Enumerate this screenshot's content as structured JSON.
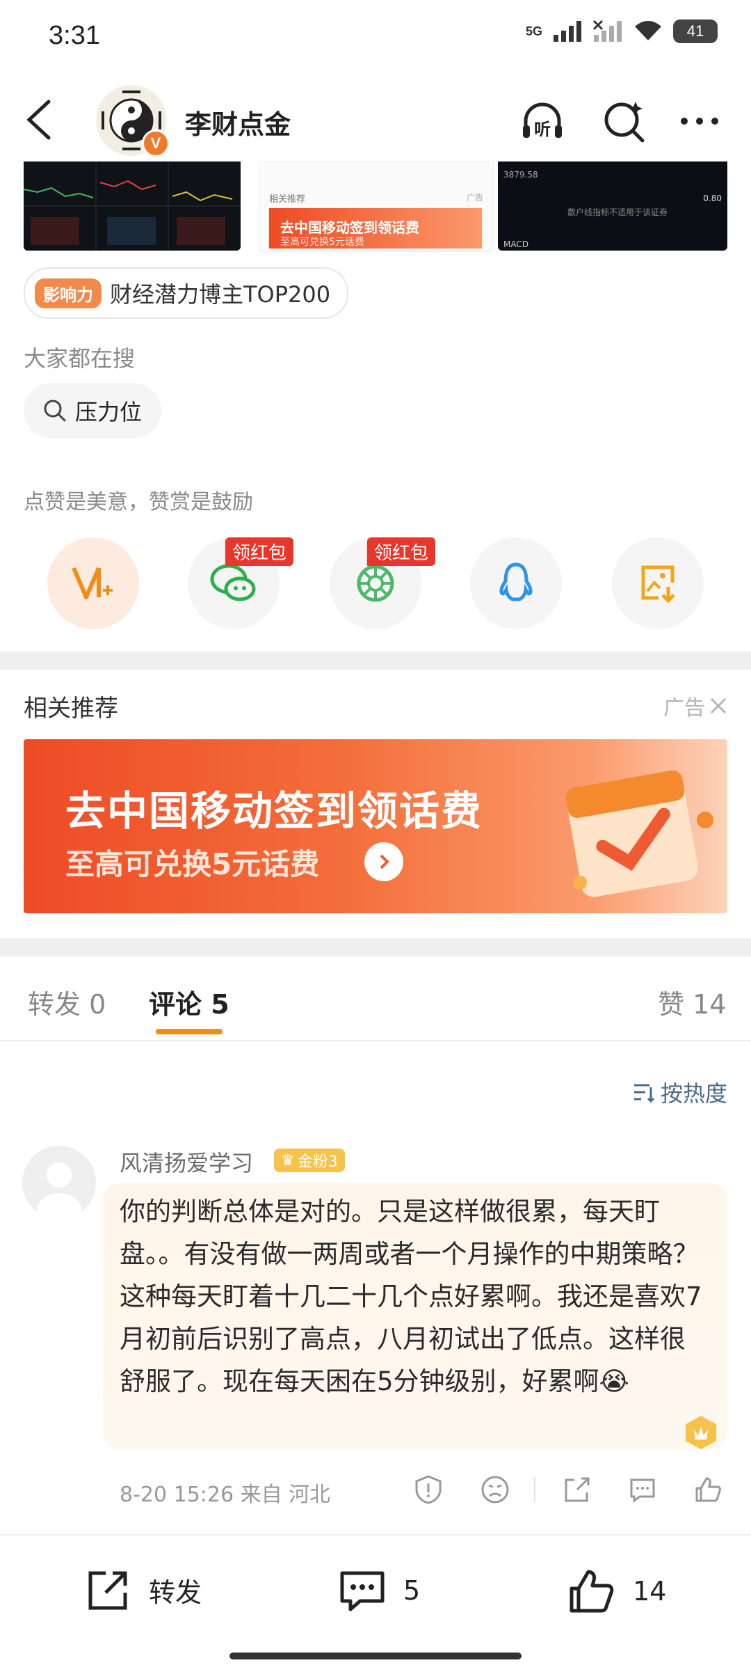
{
  "status_bar": {
    "time": "3:31",
    "battery": "41",
    "network": "5G"
  },
  "header": {
    "user_name": "李财点金",
    "verified_label": "V"
  },
  "icons": {
    "back": "back-arrow-icon",
    "listen": "headphone-listen-icon",
    "listen_label": "听",
    "search": "search-sparkle-icon",
    "more": "more-dots-icon"
  },
  "thumbs": {
    "t2_tag": "相关推荐",
    "t2_ad": "广告",
    "t2_title": "去中国移动签到领话费",
    "t2_sub": "至高可兑换5元话费",
    "t3_label": "散户线指标不适用于该证券",
    "t3_price": "3879.58",
    "t3_macd": "MACD",
    "t3_val": "0.80"
  },
  "influence": {
    "tag": "影响力",
    "text": "财经潜力博主TOP200"
  },
  "search": {
    "title": "大家都在搜",
    "chip": "压力位"
  },
  "reward": {
    "text": "点赞是美意，赞赏是鼓励",
    "red_tag": "领红包"
  },
  "recommend": {
    "title": "相关推荐",
    "ad_label": "广告",
    "banner_title": "去中国移动签到领话费",
    "banner_sub": "至高可兑换5元话费"
  },
  "tabs": {
    "repost": "转发 0",
    "comment": "评论 5",
    "like": "赞 14"
  },
  "sort": {
    "label": "按热度"
  },
  "comment": {
    "user": "风清扬爱学习",
    "badge": "金粉3",
    "text": "你的判断总体是对的。只是这样做很累，每天盯盘。。有没有做一两周或者一个月操作的中期策略？这种每天盯着十几二十几个点好累啊。我还是喜欢7月初前后识别了高点，八月初试出了低点。这样很舒服了。现在每天困在5分钟级别，好累啊",
    "emoji": "😭",
    "meta": "8-20 15:26  来自 河北"
  },
  "bottom_bar": {
    "repost": "转发",
    "comment_count": "5",
    "like_count": "14"
  },
  "colors": {
    "accent": "#f28c16",
    "brand_orange": "#f07a2b",
    "link": "#4a6b8c",
    "red": "#e8362c"
  }
}
